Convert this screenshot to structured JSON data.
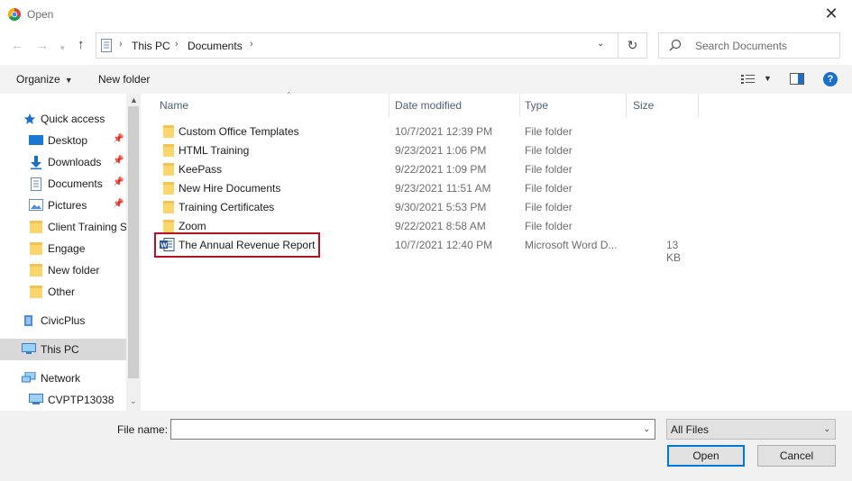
{
  "window": {
    "title": "Open"
  },
  "address": {
    "crumbs": [
      "This PC",
      "Documents"
    ]
  },
  "search": {
    "placeholder": "Search Documents"
  },
  "toolbar": {
    "organize": "Organize",
    "new_folder": "New folder"
  },
  "nav": {
    "items": [
      {
        "label": "Quick access",
        "icon": "star-icon",
        "pinned": false
      },
      {
        "label": "Desktop",
        "icon": "desktop-icon",
        "pinned": true
      },
      {
        "label": "Downloads",
        "icon": "download-icon",
        "pinned": true
      },
      {
        "label": "Documents",
        "icon": "documents-icon",
        "pinned": true
      },
      {
        "label": "Pictures",
        "icon": "pictures-icon",
        "pinned": true
      },
      {
        "label": "Client Training S",
        "icon": "folder-icon",
        "pinned": false
      },
      {
        "label": "Engage",
        "icon": "folder-icon",
        "pinned": false
      },
      {
        "label": "New folder",
        "icon": "folder-icon",
        "pinned": false
      },
      {
        "label": "Other",
        "icon": "folder-icon",
        "pinned": false
      },
      {
        "label": "CivicPlus",
        "icon": "cloud-icon",
        "pinned": false
      },
      {
        "label": "This PC",
        "icon": "this-pc-icon",
        "pinned": false
      },
      {
        "label": "Network",
        "icon": "network-icon",
        "pinned": false
      },
      {
        "label": "CVPTP13038",
        "icon": "computer-icon",
        "pinned": false
      }
    ],
    "selected": "This PC"
  },
  "columns": {
    "name": "Name",
    "date": "Date modified",
    "type": "Type",
    "size": "Size"
  },
  "files": [
    {
      "name": "Custom Office Templates",
      "date": "10/7/2021 12:39 PM",
      "type": "File folder",
      "size": "",
      "icon": "folder-icon"
    },
    {
      "name": "HTML Training",
      "date": "9/23/2021 1:06 PM",
      "type": "File folder",
      "size": "",
      "icon": "folder-icon"
    },
    {
      "name": "KeePass",
      "date": "9/22/2021 1:09 PM",
      "type": "File folder",
      "size": "",
      "icon": "folder-icon"
    },
    {
      "name": "New Hire Documents",
      "date": "9/23/2021 11:51 AM",
      "type": "File folder",
      "size": "",
      "icon": "folder-icon"
    },
    {
      "name": "Training Certificates",
      "date": "9/30/2021 5:53 PM",
      "type": "File folder",
      "size": "",
      "icon": "folder-icon"
    },
    {
      "name": "Zoom",
      "date": "9/22/2021 8:58 AM",
      "type": "File folder",
      "size": "",
      "icon": "folder-icon"
    },
    {
      "name": "The Annual Revenue Report",
      "date": "10/7/2021 12:40 PM",
      "type": "Microsoft Word D...",
      "size": "13 KB",
      "icon": "word-document-icon"
    }
  ],
  "footer": {
    "file_name_label": "File name:",
    "file_name_value": "",
    "filter_value": "All Files",
    "open_label": "Open",
    "cancel_label": "Cancel"
  },
  "colors": {
    "highlight": "#b3121e",
    "accent": "#0078d7",
    "folder": "#f3c24f"
  }
}
